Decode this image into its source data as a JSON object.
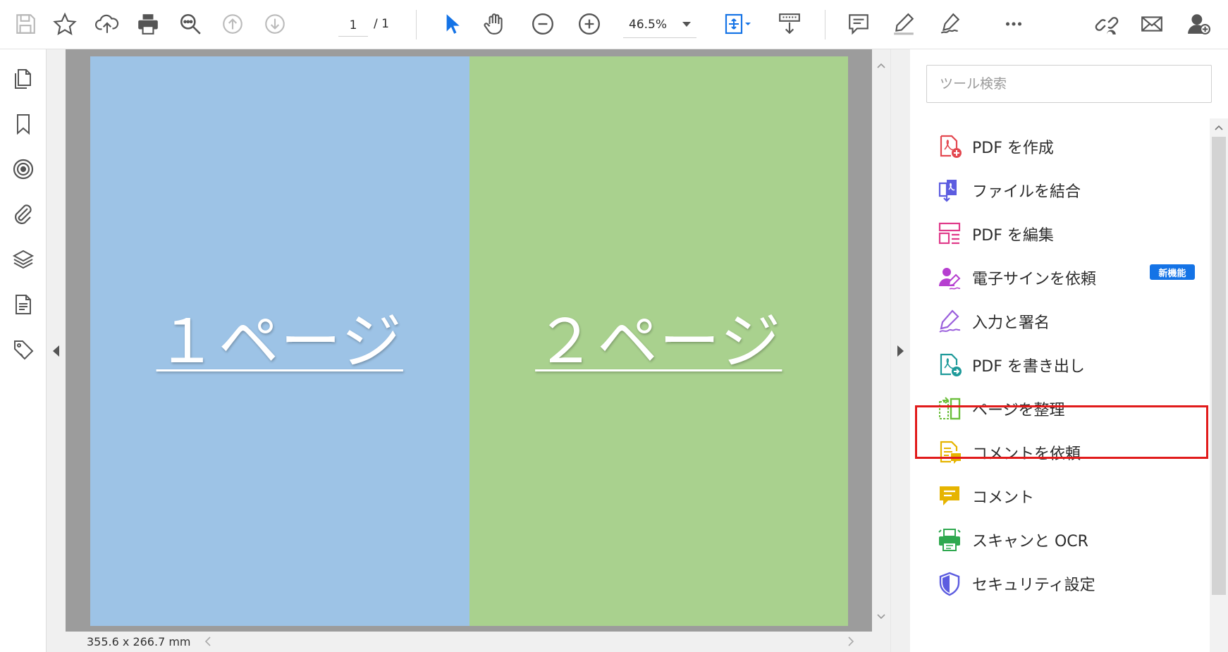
{
  "toolbar": {
    "page_current": "1",
    "page_total": "/ 1",
    "zoom_value": "46.5%",
    "icons": [
      "save-icon",
      "star-icon",
      "cloud-upload-icon",
      "print-icon",
      "search-zoom-icon",
      "page-up-icon",
      "page-down-icon",
      "select-arrow-icon",
      "hand-icon",
      "zoom-out-icon",
      "zoom-in-icon",
      "fit-page-icon",
      "scroll-mode-icon",
      "comment-icon",
      "highlight-pen-icon",
      "sign-pen-icon",
      "more-icon",
      "share-link-icon",
      "email-icon",
      "add-user-icon"
    ]
  },
  "left_nav": {
    "icons": [
      "pages-icon",
      "bookmark-icon",
      "target-icon",
      "attachment-icon",
      "layers-icon",
      "document-icon",
      "tag-icon"
    ]
  },
  "document": {
    "page1_label": "１ページ",
    "page2_label": "２ページ",
    "page1_color": "#9dc3e6",
    "page2_color": "#a9d18e",
    "page_size": "355.6 x 266.7 mm"
  },
  "tools_panel": {
    "search_placeholder": "ツール検索",
    "new_badge": "新機能",
    "highlight_color": "#e11b1b",
    "items": [
      {
        "label": "PDF を作成",
        "icon": "create-pdf-icon",
        "color": "#e34850"
      },
      {
        "label": "ファイルを結合",
        "icon": "combine-files-icon",
        "color": "#5c5ce0"
      },
      {
        "label": "PDF を編集",
        "icon": "edit-pdf-icon",
        "color": "#e03a8a"
      },
      {
        "label": "電子サインを依頼",
        "icon": "request-signature-icon",
        "color": "#b63fd0"
      },
      {
        "label": "入力と署名",
        "icon": "fill-sign-icon",
        "color": "#9a5fdc"
      },
      {
        "label": "PDF を書き出し",
        "icon": "export-pdf-icon",
        "color": "#1e9a9a"
      },
      {
        "label": "ページを整理",
        "icon": "organize-pages-icon",
        "color": "#6cbf3c"
      },
      {
        "label": "コメントを依頼",
        "icon": "request-comment-icon",
        "color": "#e6b400"
      },
      {
        "label": "コメント",
        "icon": "comment-tool-icon",
        "color": "#e6b400"
      },
      {
        "label": "スキャンと OCR",
        "icon": "scan-ocr-icon",
        "color": "#2fa84f"
      },
      {
        "label": "セキュリティ設定",
        "icon": "security-icon",
        "color": "#5c5ce0"
      }
    ]
  }
}
